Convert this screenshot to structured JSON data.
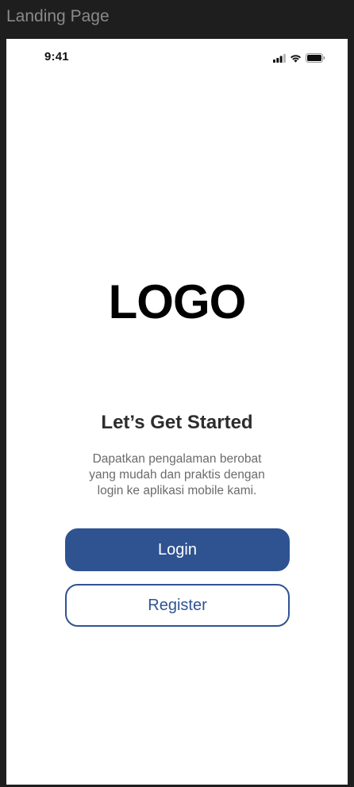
{
  "frame": {
    "title": "Landing Page"
  },
  "status_bar": {
    "time": "9:41",
    "icons": [
      "signal-icon",
      "wifi-icon",
      "battery-icon"
    ]
  },
  "logo": {
    "text": "LOGO"
  },
  "hero": {
    "title": "Let’s Get Started",
    "subtitle_lines": [
      "Dapatkan pengalaman berobat",
      "yang mudah dan praktis dengan",
      "login ke aplikasi mobile kami."
    ]
  },
  "actions": {
    "login_label": "Login",
    "register_label": "Register"
  },
  "colors": {
    "primary": "#2f5391",
    "background": "#1e1e1e",
    "screen": "#ffffff",
    "heading": "#2d2d2d",
    "body_text": "#6b6b6b"
  }
}
